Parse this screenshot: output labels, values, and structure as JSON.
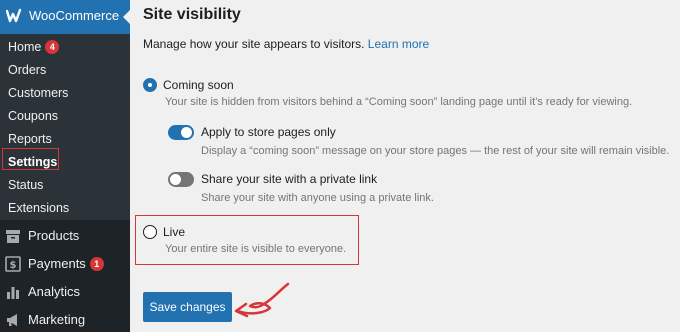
{
  "sidebar": {
    "header_title": "WooCommerce",
    "submenu": [
      {
        "label": "Home",
        "badge": "4"
      },
      {
        "label": "Orders"
      },
      {
        "label": "Customers"
      },
      {
        "label": "Coupons"
      },
      {
        "label": "Reports"
      },
      {
        "label": "Settings",
        "active": true
      },
      {
        "label": "Status"
      },
      {
        "label": "Extensions"
      }
    ],
    "main_items": [
      {
        "label": "Products",
        "icon": "archive-icon"
      },
      {
        "label": "Payments",
        "icon": "dollar-icon",
        "badge": "1"
      },
      {
        "label": "Analytics",
        "icon": "bar-chart-icon"
      },
      {
        "label": "Marketing",
        "icon": "megaphone-icon"
      }
    ]
  },
  "content": {
    "title": "Site visibility",
    "description": "Manage how your site appears to visitors.",
    "learn_more": "Learn more",
    "coming_soon": {
      "label": "Coming soon",
      "help": "Your site is hidden from visitors behind a “Coming soon” landing page until it’s ready for viewing.",
      "selected": true
    },
    "store_pages_toggle": {
      "label": "Apply to store pages only",
      "help": "Display a “coming soon” message on your store pages — the rest of your site will remain visible.",
      "enabled": true
    },
    "private_link_toggle": {
      "label": "Share your site with a private link",
      "help": "Share your site with anyone using a private link.",
      "enabled": false
    },
    "live": {
      "label": "Live",
      "help": "Your entire site is visible to everyone.",
      "selected": false
    },
    "save_label": "Save changes"
  },
  "colors": {
    "accent": "#2271b1",
    "sidebar_bg": "#1d2327",
    "submenu_bg": "#2c3338",
    "highlight_red": "#d63638"
  }
}
